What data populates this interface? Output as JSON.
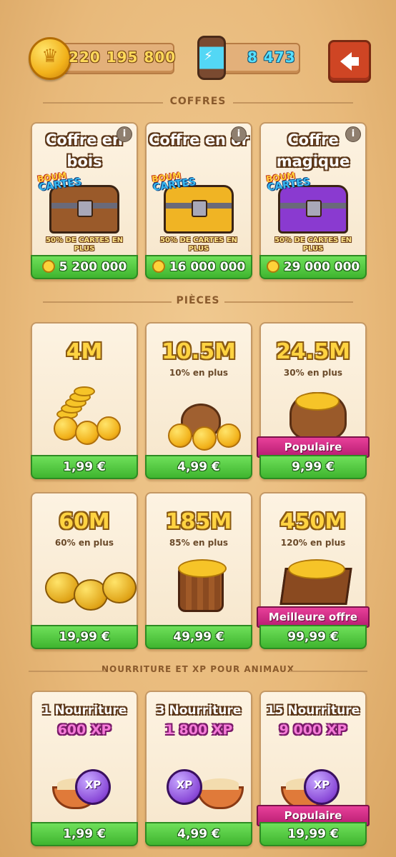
{
  "header": {
    "coins": "220 195 800",
    "spins": "8 473"
  },
  "sections": {
    "chests": "COFFRES",
    "coins": "PIÈCES",
    "pet_food": "NOURRITURE ET XP POUR ANIMAUX"
  },
  "chests": [
    {
      "title": "Coffre en bois",
      "badge_line1": "BOUM",
      "badge_line2": "CARTES",
      "bonus": "50% DE CARTES EN PLUS",
      "price": "5 200 000",
      "color": "#9a5a2a"
    },
    {
      "title": "Coffre en or",
      "badge_line1": "BOUM",
      "badge_line2": "CARTES",
      "bonus": "50% DE CARTES EN PLUS",
      "price": "16 000 000",
      "color": "#f0b424"
    },
    {
      "title": "Coffre magique",
      "badge_line1": "BOUM",
      "badge_line2": "CARTES",
      "bonus": "50% DE CARTES EN PLUS",
      "price": "29 000 000",
      "color": "#8a3ad0"
    }
  ],
  "coin_packs": [
    {
      "amount": "4M",
      "extra": "",
      "price": "1,99 €",
      "ribbon": ""
    },
    {
      "amount": "10.5M",
      "extra": "10% en plus",
      "price": "4,99 €",
      "ribbon": ""
    },
    {
      "amount": "24.5M",
      "extra": "30% en plus",
      "price": "9,99 €",
      "ribbon": "Populaire"
    },
    {
      "amount": "60M",
      "extra": "60% en plus",
      "price": "19,99 €",
      "ribbon": ""
    },
    {
      "amount": "185M",
      "extra": "85% en plus",
      "price": "49,99 €",
      "ribbon": ""
    },
    {
      "amount": "450M",
      "extra": "120% en plus",
      "price": "99,99 €",
      "ribbon": "Meilleure offre"
    }
  ],
  "food_packs": [
    {
      "title": "1 Nourriture",
      "xp": "600 XP",
      "price": "1,99 €",
      "ribbon": "",
      "potion_label": "XP"
    },
    {
      "title": "3 Nourriture",
      "xp": "1 800 XP",
      "price": "4,99 €",
      "ribbon": "",
      "potion_label": "XP"
    },
    {
      "title": "15 Nourriture",
      "xp": "9 000 XP",
      "price": "19,99 €",
      "ribbon": "Populaire",
      "potion_label": "XP"
    }
  ],
  "icons": {
    "coin": "coin-icon",
    "spin": "spin-capsule-icon",
    "back": "back-arrow-icon",
    "info": "info-icon"
  }
}
